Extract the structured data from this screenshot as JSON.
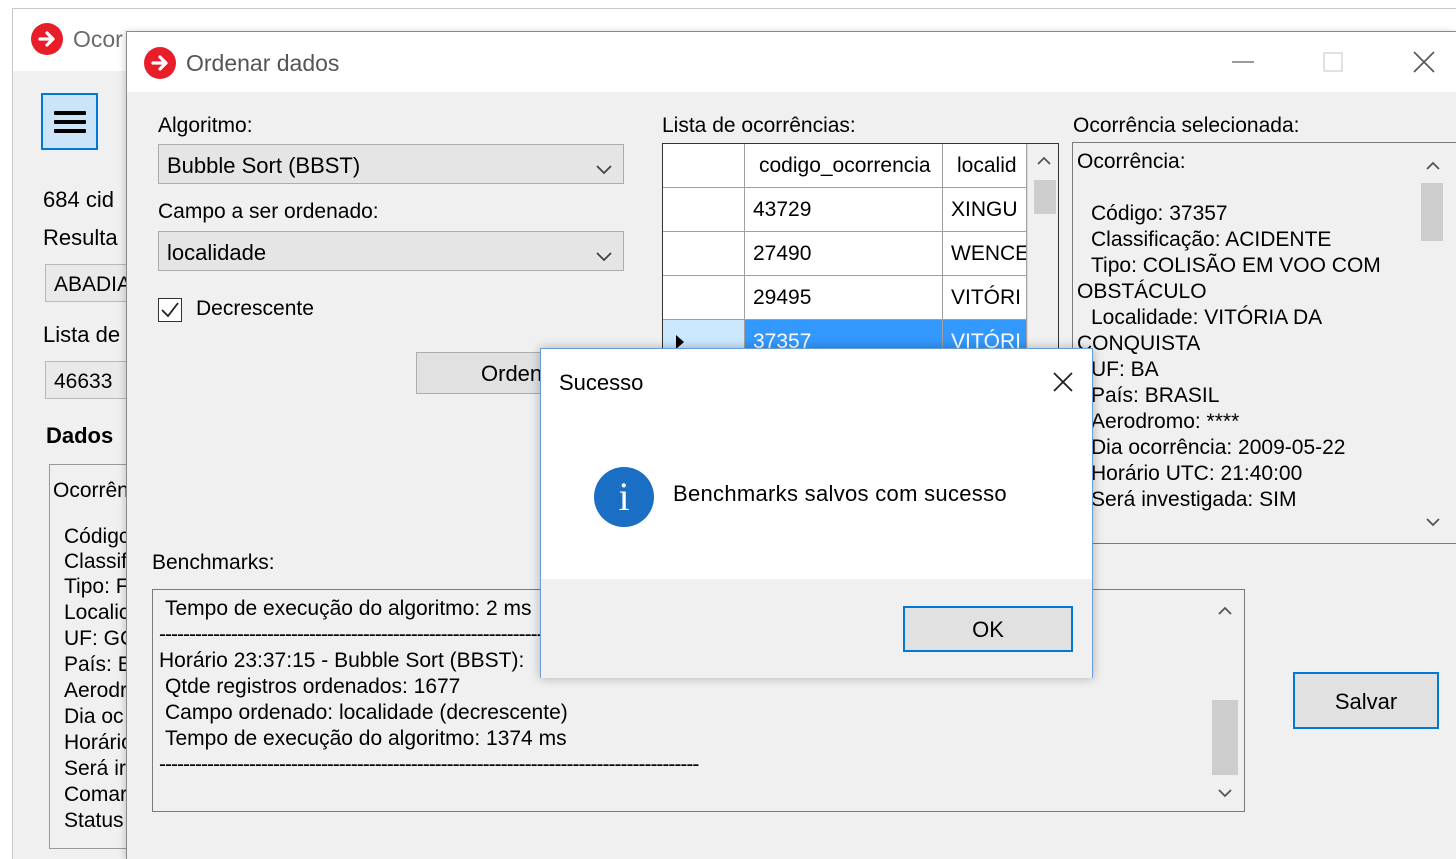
{
  "main_window": {
    "title": "Ocor",
    "count_text": "684 cid",
    "result_label": "Resulta",
    "result_value": "ABADIA",
    "list_label": "Lista de",
    "list_value": "46633",
    "dados_label": "Dados",
    "dados_lines": [
      "Ocorrên",
      "Códigc",
      "Classifi",
      "Tipo: F",
      "Localic",
      "UF: GC",
      "País: E",
      "Aerodr",
      "Dia oc",
      "Horáric",
      "Será ir",
      "Comar",
      "Status"
    ]
  },
  "order_dialog": {
    "title": "Ordenar dados",
    "algoritmo_label": "Algoritmo:",
    "algoritmo_value": "Bubble Sort (BBST)",
    "campo_label": "Campo a ser ordenado:",
    "campo_value": "localidade",
    "decrescente_label": "Decrescente",
    "decrescente_checked": true,
    "ordenar_button": "Orden",
    "lista_label": "Lista de ocorrências:",
    "grid": {
      "columns": [
        "codigo_ocorrencia",
        "localid"
      ],
      "rows": [
        {
          "codigo": "43729",
          "localidade": "XINGU"
        },
        {
          "codigo": "27490",
          "localidade": "WENCE"
        },
        {
          "codigo": "29495",
          "localidade": "VITÓRI"
        },
        {
          "codigo": "37357",
          "localidade": "VITÓRI"
        }
      ],
      "selected_row": 3
    },
    "selected_label": "Ocorrência selecionada:",
    "selected_lines": [
      "Ocorrência:",
      "Código: 37357",
      "Classificação: ACIDENTE",
      "Tipo: COLISÃO EM VOO COM",
      "OBSTÁCULO",
      "Localidade: VITÓRIA DA",
      "CONQUISTA",
      "UF: BA",
      "País: BRASIL",
      "Aerodromo: ****",
      "Dia ocorrência: 2009-05-22",
      "Horário UTC: 21:40:00",
      "Será investigada: SIM"
    ],
    "benchmarks_label": "Benchmarks:",
    "bench_lines": [
      "Tempo de execução do algoritmo: 2 ms",
      "----------------------------------------------------------------",
      "Horário 23:37:15 - Bubble Sort (BBST):",
      "Qtde registros ordenados: 1677",
      "Campo ordenado: localidade  (decrescente)",
      "Tempo de execução do algoritmo: 1374 ms",
      "------------------------------------------------------------------------------------------"
    ],
    "salvar_button": "Salvar"
  },
  "message_box": {
    "title": "Sucesso",
    "message": "Benchmarks salvos com sucesso",
    "ok_label": "OK"
  },
  "colors": {
    "app_icon": "#e81d2a",
    "selection": "#3399ff",
    "focus_border": "#0078d7",
    "info_icon": "#1a6fc4"
  }
}
